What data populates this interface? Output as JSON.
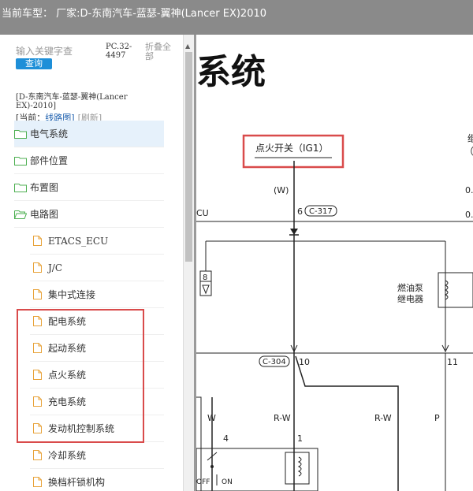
{
  "window": {
    "title": "当前车型： 厂家:D-东南汽车-蓝瑟-翼神(Lancer EX)2010"
  },
  "sidebar": {
    "search_placeholder": "输入关键字查",
    "search_button": "查询",
    "pc_code": "PC.32-4497",
    "fold_all": "折叠全部",
    "vehicle_path": "[D-东南汽车-蓝瑟-翼神(Lancer EX)-2010]",
    "current_label": "[当前：",
    "current_value": "线路图]",
    "refresh": "[刷新]",
    "tree": [
      {
        "label": "电气系统",
        "icon": "folder-icon",
        "level": 0,
        "selected": true
      },
      {
        "label": "部件位置",
        "icon": "folder-icon",
        "level": 0
      },
      {
        "label": "布置图",
        "icon": "folder-icon",
        "level": 0
      },
      {
        "label": "电路图",
        "icon": "folder-open-icon",
        "level": 0
      },
      {
        "label": "ETACS_ECU",
        "icon": "file-icon",
        "level": 1
      },
      {
        "label": "J/C",
        "icon": "file-icon",
        "level": 1
      },
      {
        "label": "集中式连接",
        "icon": "file-icon",
        "level": 1
      },
      {
        "label": "配电系统",
        "icon": "file-icon",
        "level": 1
      },
      {
        "label": "起动系统",
        "icon": "file-icon",
        "level": 1
      },
      {
        "label": "点火系统",
        "icon": "file-icon",
        "level": 1
      },
      {
        "label": "充电系统",
        "icon": "file-icon",
        "level": 1
      },
      {
        "label": "发动机控制系统",
        "icon": "file-icon",
        "level": 1
      },
      {
        "label": "冷却系统",
        "icon": "file-icon",
        "level": 1
      },
      {
        "label": "换档杆锁机构",
        "icon": "file-icon",
        "level": 1
      }
    ]
  },
  "diagram": {
    "heading": "系统",
    "ignition_switch": "点火开关（IG1）",
    "wire_w": "(W)",
    "pin_6": "6",
    "connector_c317": "C-317",
    "cu_label": "CU",
    "ground_8": "8",
    "relay_label_1": "燃油泵",
    "relay_label_2": "继电器",
    "connector_c304": "C-304",
    "pin_10": "10",
    "pin_11": "11",
    "right_top_1": "继",
    "right_top_2": "（",
    "right_val_1": "0.",
    "right_val_2": "0.",
    "wire_w2": "W",
    "wire_rw1": "R-W",
    "wire_rw2": "R-W",
    "wire_p": "P",
    "pin_4": "4",
    "pin_1": "1",
    "switch_off": "OFF",
    "switch_on": "ON"
  },
  "colors": {
    "titlebar": "#8a8a8a",
    "highlight": "#d94b4b",
    "search_button": "#1e8fd8",
    "folder": "#4caf50",
    "file": "#e8a33a"
  }
}
